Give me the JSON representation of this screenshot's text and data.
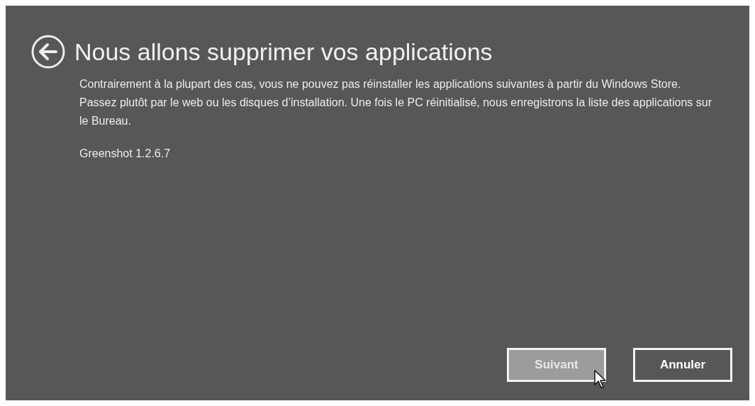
{
  "title": "Nous allons supprimer vos applications",
  "description": "Contrairement à la plupart des cas, vous ne pouvez pas réinstaller les applications suivantes à partir du Windows Store. Passez plutôt par le web ou les disques d’installation. Une fois le PC réinitialisé, nous enregistrons la liste des applications sur le Bureau.",
  "apps": [
    "Greenshot 1.2.6.7"
  ],
  "buttons": [
    {
      "label": "Suivant",
      "hovered": true
    },
    {
      "label": "Annuler",
      "hovered": false
    }
  ]
}
